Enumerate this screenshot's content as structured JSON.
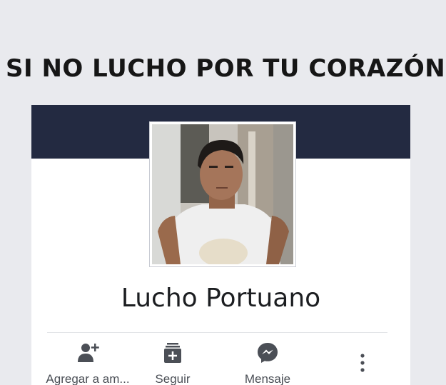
{
  "caption": "SI NO LUCHO POR TU CORAZÓN..",
  "profile": {
    "name": "Lucho Portuano"
  },
  "actions": [
    {
      "label": "Agregar a am...",
      "icon": "add-friend-icon"
    },
    {
      "label": "Seguir",
      "icon": "follow-icon"
    },
    {
      "label": "Mensaje",
      "icon": "messenger-icon"
    },
    {
      "label": "",
      "icon": "more-options-icon"
    }
  ],
  "colors": {
    "cover": "#232a41",
    "icon": "#4b4f56",
    "background": "#e9eaee"
  }
}
